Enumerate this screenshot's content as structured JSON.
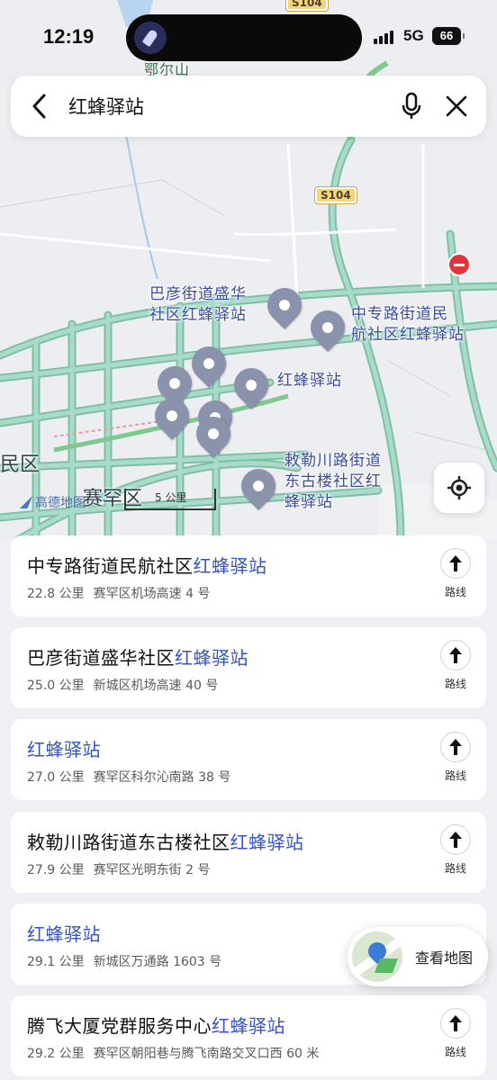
{
  "status_bar": {
    "time": "12:19",
    "network": "5G",
    "battery": "66"
  },
  "search": {
    "query": "红蜂驿站",
    "back_icon": "chevron-left-icon",
    "mic_icon": "microphone-icon",
    "clear_icon": "close-icon"
  },
  "map": {
    "road_badges": [
      "S104",
      "S104"
    ],
    "top_label": "鄂尔山",
    "poi_labels": [
      {
        "line1": "巴彦街道盛华",
        "line2": "社区红蜂驿站",
        "line3": ""
      },
      {
        "line1": "中专路街道民",
        "line2": "航社区红蜂驿站",
        "line3": ""
      },
      {
        "line1": "红蜂驿站",
        "line2": "",
        "line3": ""
      },
      {
        "line1": "敕勒川路街道",
        "line2": "东古楼社区红",
        "line3": "蜂驿站"
      }
    ],
    "district_left": "民区",
    "district_main": "赛罕区",
    "logo": "高德地图",
    "scale": "5 公里",
    "colors": {
      "road": "#a9dcc8",
      "road_outline": "#7fbfa7",
      "pin": "#8a93ab",
      "highlight": "#3453c4"
    }
  },
  "results": [
    {
      "prefix": "中专路街道民航社区",
      "highlight": "红蜂驿站",
      "distance": "22.8 公里",
      "address": "赛罕区机场高速 4 号",
      "route_label": "路线"
    },
    {
      "prefix": "巴彦街道盛华社区",
      "highlight": "红蜂驿站",
      "distance": "25.0 公里",
      "address": "新城区机场高速 40 号",
      "route_label": "路线"
    },
    {
      "prefix": "",
      "highlight": "红蜂驿站",
      "distance": "27.0 公里",
      "address": "赛罕区科尔沁南路 38 号",
      "route_label": "路线"
    },
    {
      "prefix": "敕勒川路街道东古楼社区",
      "highlight": "红蜂驿站",
      "distance": "27.9 公里",
      "address": "赛罕区光明东街 2 号",
      "route_label": "路线"
    },
    {
      "prefix": "",
      "highlight": "红蜂驿站",
      "distance": "29.1 公里",
      "address": "新城区万通路 1603 号",
      "route_label": ""
    },
    {
      "prefix": "腾飞大厦党群服务中心",
      "highlight": "红蜂驿站",
      "distance": "29.2 公里",
      "address": "赛罕区朝阳巷与腾飞南路交叉口西 60 米",
      "route_label": "路线"
    }
  ],
  "view_map": {
    "label": "查看地图",
    "icon": "map-thumbnail-icon"
  }
}
